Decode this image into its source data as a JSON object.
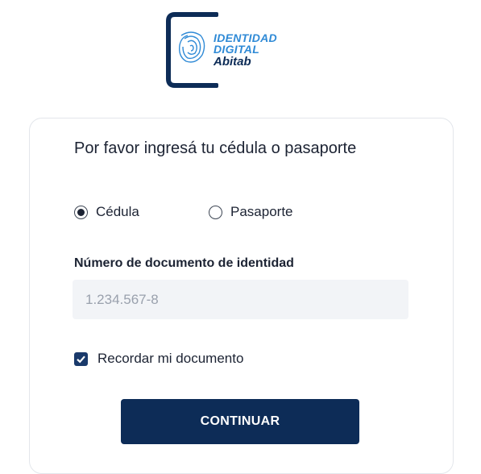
{
  "logo": {
    "line1": "IDENTIDAD",
    "line2": "DIGITAL",
    "line3": "Abitab"
  },
  "form": {
    "title": "Por favor ingresá tu cédula o pasaporte",
    "doc_types": [
      {
        "label": "Cédula",
        "selected": true
      },
      {
        "label": "Pasaporte",
        "selected": false
      }
    ],
    "doc_number_label": "Número de documento de identidad",
    "doc_number_placeholder": "1.234.567-8",
    "doc_number_value": "",
    "remember_label": "Recordar mi documento",
    "remember_checked": true,
    "continue_label": "CONTINUAR"
  },
  "colors": {
    "primary": "#0d2c57",
    "logo_blue": "#2f8ad6",
    "input_bg": "#f2f4f7",
    "placeholder": "#9aa1ad"
  },
  "icons": {
    "logo": "phone-fingerprint-icon",
    "checkbox": "checkmark-icon"
  }
}
